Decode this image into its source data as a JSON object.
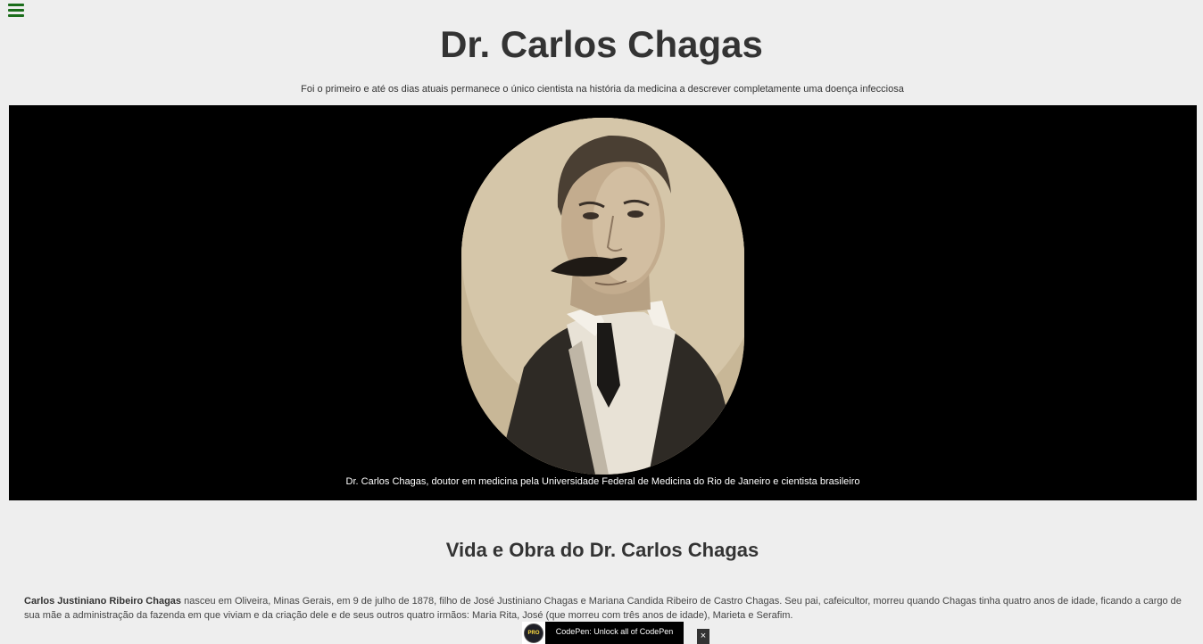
{
  "header": {
    "menu_icon": "hamburger-menu-icon",
    "menu_color": "#1b6d1b",
    "title": "Dr. Carlos Chagas",
    "subtitle": "Foi o primeiro e até os dias atuais permanece o único cientista na história da medicina a descrever completamente uma doença infecciosa"
  },
  "hero": {
    "image_alt": "portrait",
    "caption": "Dr. Carlos Chagas, doutor em medicina pela Universidade Federal de Medicina do Rio de Janeiro e cientista brasileiro"
  },
  "section": {
    "title": "Vida e Obra do Dr. Carlos Chagas",
    "bio_name": "Carlos Justiniano Ribeiro Chagas",
    "bio_text": " nasceu em Oliveira, Minas Gerais, em 9 de julho de 1878, filho de José Justiniano Chagas e Mariana Candida Ribeiro de Castro Chagas. Seu pai, cafeicultor, morreu quando Chagas tinha quatro anos de idade, ficando a cargo de sua mãe a administração da fazenda em que viviam e da criação dele e de seus outros quatro irmãos: Maria Rita, José (que morreu com três anos de idade), Marieta e Serafim."
  },
  "codepen": {
    "badge": "PRO",
    "text": "CodePen: Unlock all of CodePen",
    "close": "×"
  }
}
